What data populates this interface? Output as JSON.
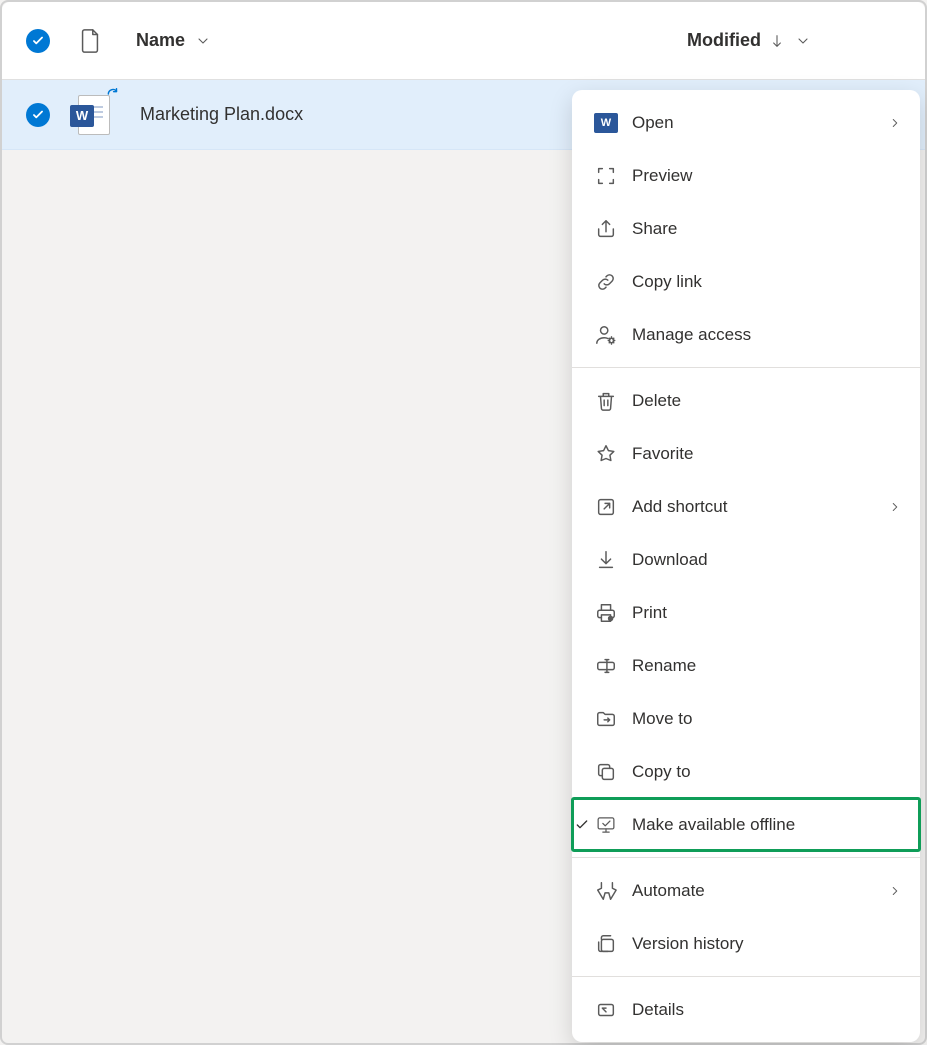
{
  "columns": {
    "name": "Name",
    "modified": "Modified"
  },
  "file": {
    "name": "Marketing Plan.docx"
  },
  "menu": {
    "open": "Open",
    "preview": "Preview",
    "share": "Share",
    "copy_link": "Copy link",
    "manage_access": "Manage access",
    "delete": "Delete",
    "favorite": "Favorite",
    "add_shortcut": "Add shortcut",
    "download": "Download",
    "print": "Print",
    "rename": "Rename",
    "move_to": "Move to",
    "copy_to": "Copy to",
    "make_available_offline": "Make available offline",
    "automate": "Automate",
    "version_history": "Version history",
    "details": "Details"
  }
}
